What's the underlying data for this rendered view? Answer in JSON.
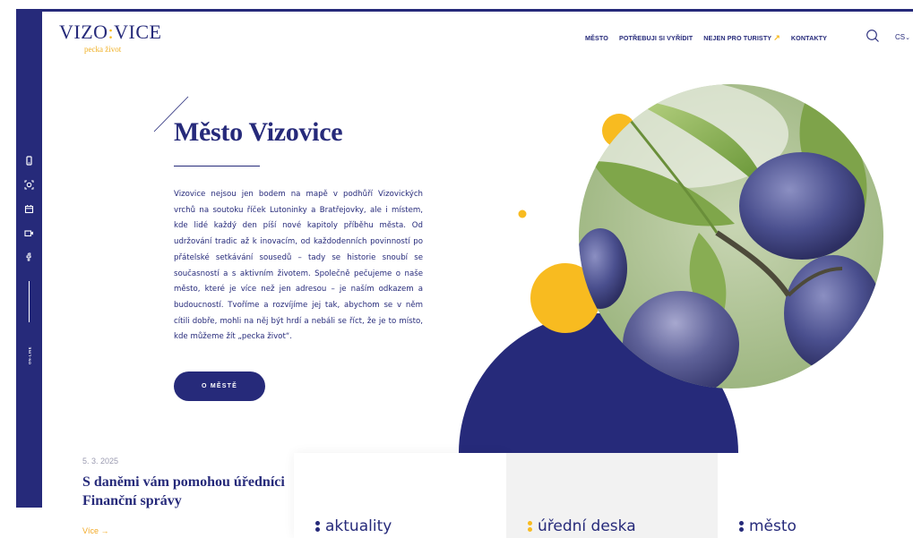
{
  "logo": {
    "main_left": "VIZO",
    "colon": ":",
    "main_right": "VICE",
    "tagline": "pecka život"
  },
  "nav": {
    "items": [
      "MĚSTO",
      "POTŘEBUJI SI VYŘÍDIT",
      "NEJEN PRO TURISTY"
    ],
    "turisty_arrow": "↗",
    "kontakty": "KONTAKTY",
    "lang": "CS",
    "lang_chevron": "⌄"
  },
  "sidebar": {
    "icons": [
      "phone-icon",
      "camera-icon",
      "calendar-icon",
      "video-icon",
      "facebook-icon"
    ],
    "online_label": "ON-LINE"
  },
  "hero": {
    "title": "Město Vizovice",
    "text": "Vizovice nejsou jen bodem na mapě v podhůří Vizovických vrchů na soutoku říček Lutoninky a Bratřejovky, ale i místem, kde lidé každý den píší nové kapitoly příběhu města. Od udržování tradic až k inovacím, od každodenních povinností po přátelské setkávání sousedů – tady se historie snoubí se současností a s aktivním životem. Společně pečujeme o naše město, které je více než jen adresou – je naším odkazem a budoucností. Tvoříme a rozvíjíme jej tak, abychom se v něm cítili dobře, mohli na něj být hrdí a nebáli se říct, že je to místo, kde můžeme žít „pecka život“.",
    "button": "O MĚSTĚ"
  },
  "news": {
    "date": "5. 3. 2025",
    "title": "S daněmi vám pomohou úředníci Finanční správy",
    "more": "Více →"
  },
  "panels": [
    {
      "label": "aktuality",
      "dot_color": "#262a7a"
    },
    {
      "label": "úřední deska",
      "dot_color": "#f8bb20"
    },
    {
      "label": "město",
      "dot_color": "#262a7a"
    }
  ],
  "colors": {
    "navy": "#262a7a",
    "yellow": "#f8bb20",
    "leaf": "#6f9a3c",
    "plum": "#4a4a8a"
  }
}
